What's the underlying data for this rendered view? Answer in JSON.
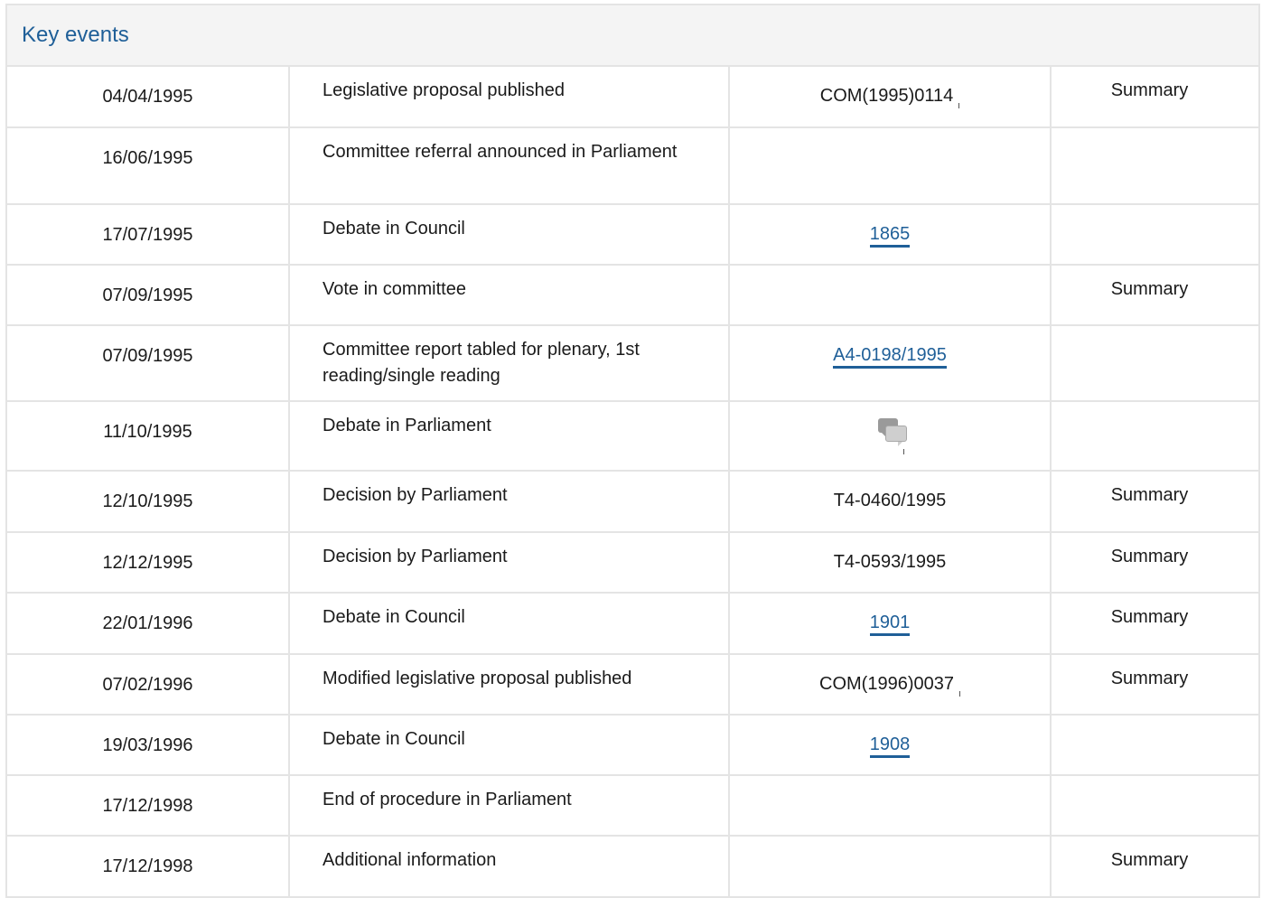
{
  "panel": {
    "title": "Key events"
  },
  "rows": [
    {
      "date": "04/04/1995",
      "event": "Legislative proposal published",
      "ref": "COM(1995)0114",
      "ref_type": "doc",
      "summary": "Summary"
    },
    {
      "date": "16/06/1995",
      "event": "Committee referral announced in Parliament",
      "ref": "",
      "ref_type": "none",
      "summary": ""
    },
    {
      "date": "17/07/1995",
      "event": "Debate in Council",
      "ref": "1865",
      "ref_type": "link",
      "summary": ""
    },
    {
      "date": "07/09/1995",
      "event": "Vote in committee",
      "ref": "",
      "ref_type": "none",
      "summary": "Summary"
    },
    {
      "date": "07/09/1995",
      "event": "Committee report tabled for plenary, 1st reading/single reading",
      "ref": "A4-0198/1995",
      "ref_type": "link",
      "summary": ""
    },
    {
      "date": "11/10/1995",
      "event": "Debate in Parliament",
      "ref": "",
      "ref_type": "icon",
      "icon": "debate-icon",
      "summary": ""
    },
    {
      "date": "12/10/1995",
      "event": "Decision by Parliament",
      "ref": "T4-0460/1995",
      "ref_type": "text",
      "summary": "Summary"
    },
    {
      "date": "12/12/1995",
      "event": "Decision by Parliament",
      "ref": "T4-0593/1995",
      "ref_type": "text",
      "summary": "Summary"
    },
    {
      "date": "22/01/1996",
      "event": "Debate in Council",
      "ref": "1901",
      "ref_type": "link",
      "summary": "Summary"
    },
    {
      "date": "07/02/1996",
      "event": "Modified legislative proposal published",
      "ref": "COM(1996)0037",
      "ref_type": "doc",
      "summary": "Summary"
    },
    {
      "date": "19/03/1996",
      "event": "Debate in Council",
      "ref": "1908",
      "ref_type": "link",
      "summary": ""
    },
    {
      "date": "17/12/1998",
      "event": "End of procedure in Parliament",
      "ref": "",
      "ref_type": "none",
      "summary": ""
    },
    {
      "date": "17/12/1998",
      "event": "Additional information",
      "ref": "",
      "ref_type": "none",
      "summary": "Summary"
    }
  ]
}
